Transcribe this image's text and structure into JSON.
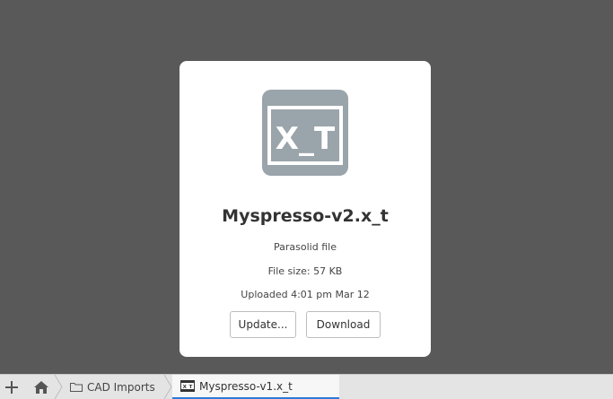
{
  "file": {
    "icon_text": "X_T",
    "name": "Myspresso-v2.x_t",
    "type": "Parasolid file",
    "size": "File size: 57 KB",
    "uploaded": "Uploaded 4:01 pm Mar 12"
  },
  "buttons": {
    "update": "Update...",
    "download": "Download"
  },
  "tabbar": {
    "add_icon": "plus-icon",
    "home_icon": "home-icon",
    "breadcrumb_folder": "CAD Imports",
    "active_tab": "Myspresso-v1.x_t"
  },
  "colors": {
    "background": "#595959",
    "icon_gray": "#9aa4ab",
    "accent": "#2f7bd6"
  }
}
